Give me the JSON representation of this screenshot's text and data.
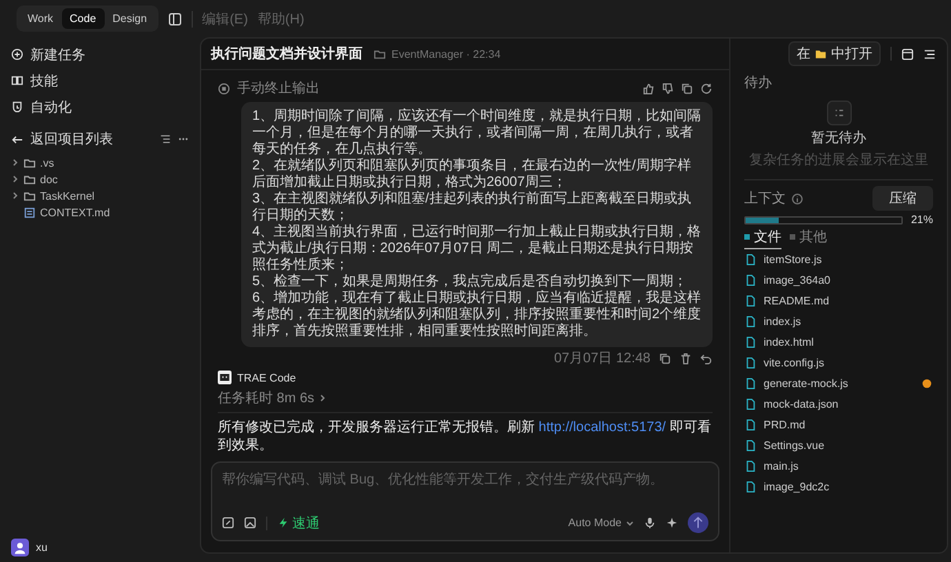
{
  "top_bar": {
    "mode_tabs": [
      {
        "label": "Work",
        "selected": false
      },
      {
        "label": "Code",
        "selected": true
      },
      {
        "label": "Design",
        "selected": false
      }
    ],
    "menu": [
      "编辑(E)",
      "帮助(H)"
    ]
  },
  "sidebar": {
    "actions": [
      {
        "kind": "new-task",
        "label": "新建任务"
      },
      {
        "kind": "skills",
        "label": "技能"
      },
      {
        "kind": "automation",
        "label": "自动化"
      }
    ],
    "back_label": "返回项目列表",
    "tree": [
      {
        "kind": "folder",
        "name": ".vs",
        "expanded": false
      },
      {
        "kind": "folder",
        "name": "doc",
        "expanded": false
      },
      {
        "kind": "folder",
        "name": "TaskKernel",
        "expanded": false
      },
      {
        "kind": "file",
        "name": "CONTEXT.md"
      }
    ],
    "user": {
      "name": "xu"
    }
  },
  "chat": {
    "title": "执行问题文档并设计界面",
    "project": "EventManager · 22:34",
    "open_in": {
      "before": "在",
      "after": "中打开"
    },
    "stop_note": "手动终止输出",
    "user_message": [
      "1、周期时间除了间隔，应该还有一个时间维度，就是执行日期，比如间隔一个月，但是在每个月的哪一天执行，或者间隔一周，在周几执行，或者每天的任务，在几点执行等。",
      "2、在就绪队列页和阻塞队列页的事项条目，在最右边的一次性/周期字样后面增加截止日期或执行日期，格式为26007周三；",
      "3、在主视图就绪队列和阻塞/挂起列表的执行前面写上距离截至日期或执行日期的天数；",
      "4、主视图当前执行界面，已运行时间那一行加上截止日期或执行日期，格式为截止/执行日期：2026年07月07日 周二，是截止日期还是执行日期按照任务性质来；",
      "5、检查一下，如果是周期任务，我点完成后是否自动切换到下一周期；",
      "6、增加功能，现在有了截止日期或执行日期，应当有临近提醒，我是这样考虑的，在主视图的就绪队列和阻塞队列，排序按照重要性和时间2个维度排序，首先按照重要性排，相同重要性按照时间距离排。"
    ],
    "message_time": "07月07日 12:48",
    "assistant": {
      "name": "TRAE Code",
      "duration": "任务耗时 8m 6s",
      "reply_before": "所有修改已完成，开发服务器运行正常无报错。刷新",
      "reply_link": "http://localhost:5173/",
      "reply_after": "即可看到效果。"
    },
    "input": {
      "placeholder": "帮你编写代码、调试 Bug、优化性能等开发工作，交付生产级代码产物。",
      "speed_label": "速通",
      "mode": "Auto Mode"
    }
  },
  "right_panel": {
    "todo_title": "待办",
    "empty_title": "暂无待办",
    "empty_hint": "复杂任务的进展会显示在这里",
    "context_label": "上下文",
    "compress_button": "压缩",
    "level": 0.21,
    "percent": "21%",
    "tabs": [
      {
        "label": "文件",
        "selected": true
      },
      {
        "label": "其他",
        "selected": false
      }
    ],
    "files": [
      {
        "name": "itemStore.js",
        "modified": false
      },
      {
        "name": "image_364a0",
        "modified": false
      },
      {
        "name": "README.md",
        "modified": false
      },
      {
        "name": "index.js",
        "modified": false
      },
      {
        "name": "index.html",
        "modified": false
      },
      {
        "name": "vite.config.js",
        "modified": false
      },
      {
        "name": "generate-mock.js",
        "modified": true
      },
      {
        "name": "mock-data.json",
        "modified": false
      },
      {
        "name": "PRD.md",
        "modified": false
      },
      {
        "name": "Settings.vue",
        "modified": false
      },
      {
        "name": "main.js",
        "modified": false
      },
      {
        "name": "image_9dc2c",
        "modified": false
      }
    ]
  }
}
